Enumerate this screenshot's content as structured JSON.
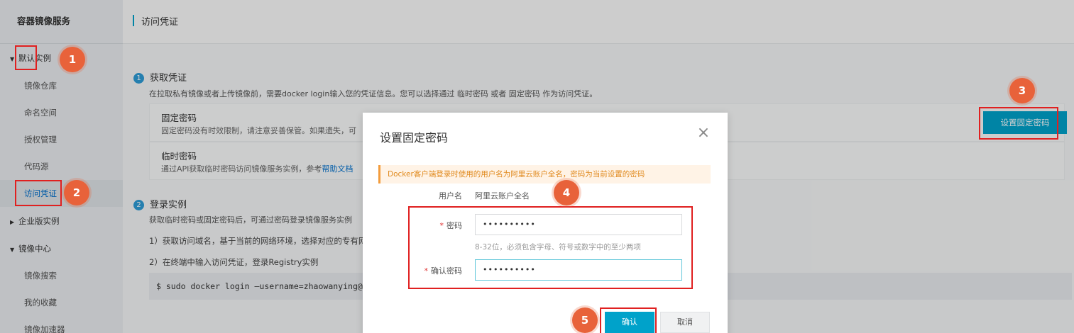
{
  "sidebar": {
    "title": "容器镜像服务",
    "groups": {
      "default": "默认实例",
      "enterprise": "企业版实例",
      "mirror_center": "镜像中心"
    },
    "items": {
      "repo": "镜像仓库",
      "namespace": "命名空间",
      "auth": "授权管理",
      "code_source": "代码源",
      "access_credential": "访问凭证",
      "mirror_search": "镜像搜索",
      "my_favorites": "我的收藏",
      "mirror_accelerator": "镜像加速器"
    }
  },
  "header": {
    "title": "访问凭证"
  },
  "section1": {
    "number": "1",
    "title": "获取凭证",
    "desc": "在拉取私有镜像或者上传镜像前，需要docker login输入您的凭证信息。您可以选择通过 临时密码 或者 固定密码 作为访问凭证。",
    "fixed": {
      "title": "固定密码",
      "desc": "固定密码没有时效限制，请注意妥善保管。如果遗失，可"
    },
    "temp": {
      "title": "临时密码",
      "desc": "通过API获取临时密码访问镜像服务实例，参考",
      "link": "帮助文档"
    },
    "set_button": "设置固定密码"
  },
  "section2": {
    "number": "2",
    "title": "登录实例",
    "desc": "获取临时密码或固定密码后，可通过密码登录镜像服务实例",
    "step1": "1）获取访问域名，基于当前的网络环境，选择对应的专有网",
    "step2": "2）在终端中输入访问凭证，登录Registry实例",
    "command": "$ sudo docker login —username=zhaowanying@cont"
  },
  "modal": {
    "title": "设置固定密码",
    "close": "×",
    "notice": "Docker客户端登录时使用的用户名为阿里云账户全名，密码为当前设置的密码",
    "username_label": "用户名",
    "username_value": "阿里云账户全名",
    "password_label": "密码",
    "password_value": "••••••••••",
    "password_hint": "8-32位，必须包含字母、符号或数字中的至少两项",
    "confirm_label": "确认密码",
    "confirm_value": "••••••••••",
    "required_mark": "*",
    "ok": "确认",
    "cancel": "取消"
  },
  "annotations": {
    "b1": "1",
    "b2": "2",
    "b3": "3",
    "b4": "4",
    "b5": "5"
  },
  "colors": {
    "accent": "#00a2ca",
    "annotation": "#e8623a",
    "highlight": "#e02020",
    "notice": "#e08a1e"
  }
}
